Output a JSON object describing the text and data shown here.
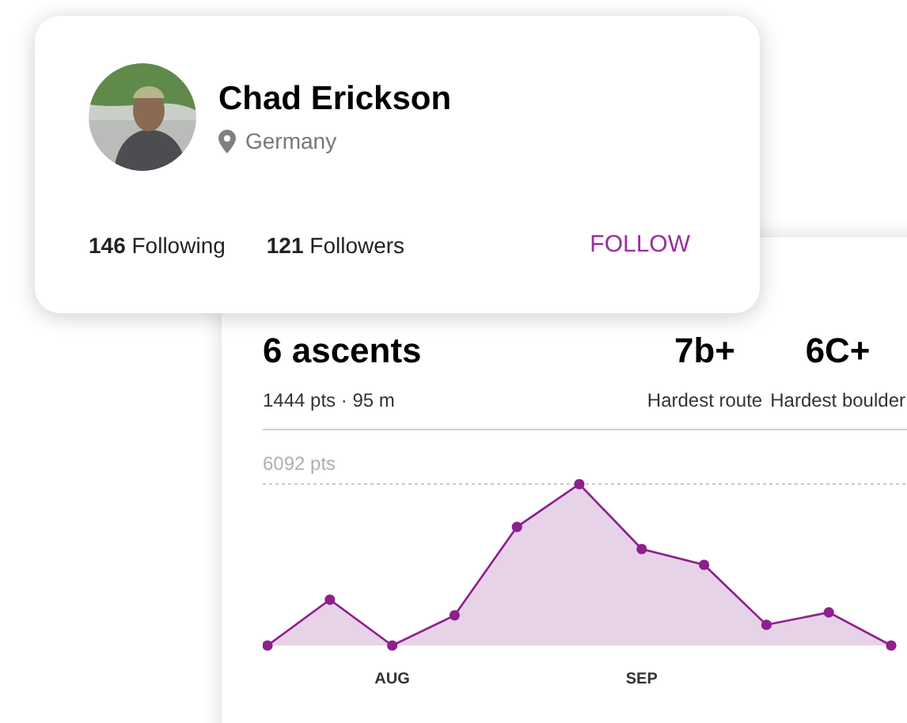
{
  "profile": {
    "name": "Chad Erickson",
    "location": "Germany",
    "following_count": "146",
    "following_label": "Following",
    "followers_count": "121",
    "followers_label": "Followers",
    "follow_button": "FOLLOW"
  },
  "stats": {
    "ascents": "6 ascents",
    "summary": "1444 pts · 95 m",
    "grades": [
      {
        "value": "7b+",
        "label": "Hardest route"
      },
      {
        "value": "6C+",
        "label": "Hardest boulder"
      }
    ],
    "chart": {
      "max_label": "6092 pts",
      "months": [
        "AUG",
        "SEP"
      ]
    }
  }
}
